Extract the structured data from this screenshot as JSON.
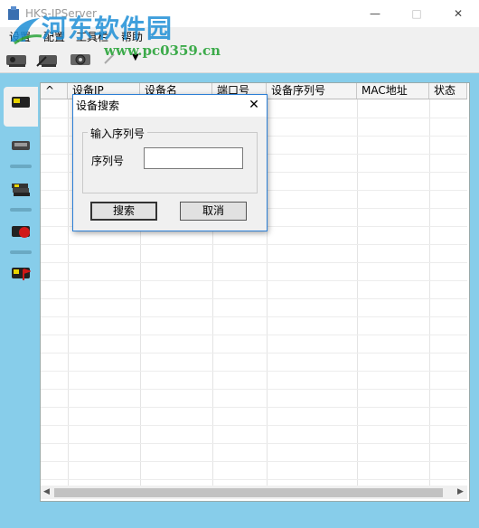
{
  "window": {
    "title": "HKS-IPServer"
  },
  "watermark": {
    "title": "河东软件园",
    "url": "www.pc0359.cn"
  },
  "menu": {
    "items": [
      "设置",
      "配置",
      "工具栏",
      "帮助"
    ]
  },
  "toolbar": {
    "dropdown_glyph": "▼"
  },
  "table": {
    "columns": [
      "^",
      "设备IP",
      "设备名",
      "端口号",
      "设备序列号",
      "MAC地址",
      "状态"
    ]
  },
  "dialog": {
    "title": "设备搜索",
    "group_label": "输入序列号",
    "serial_label": "序列号",
    "serial_value": "",
    "search_button": "搜索",
    "cancel_button": "取消",
    "close_glyph": "✕"
  },
  "colors": {
    "main_bg": "#87cdea",
    "dialog_border": "#2b7fd6",
    "watermark_blue": "#1e8fd6",
    "watermark_green": "#2aa43a"
  },
  "icons": [
    "app-icon",
    "device-icon",
    "device-add-icon",
    "device-net-icon",
    "device-alert-icon",
    "device-flag-icon",
    "camera-icon",
    "delete-icon",
    "settings-icon"
  ]
}
